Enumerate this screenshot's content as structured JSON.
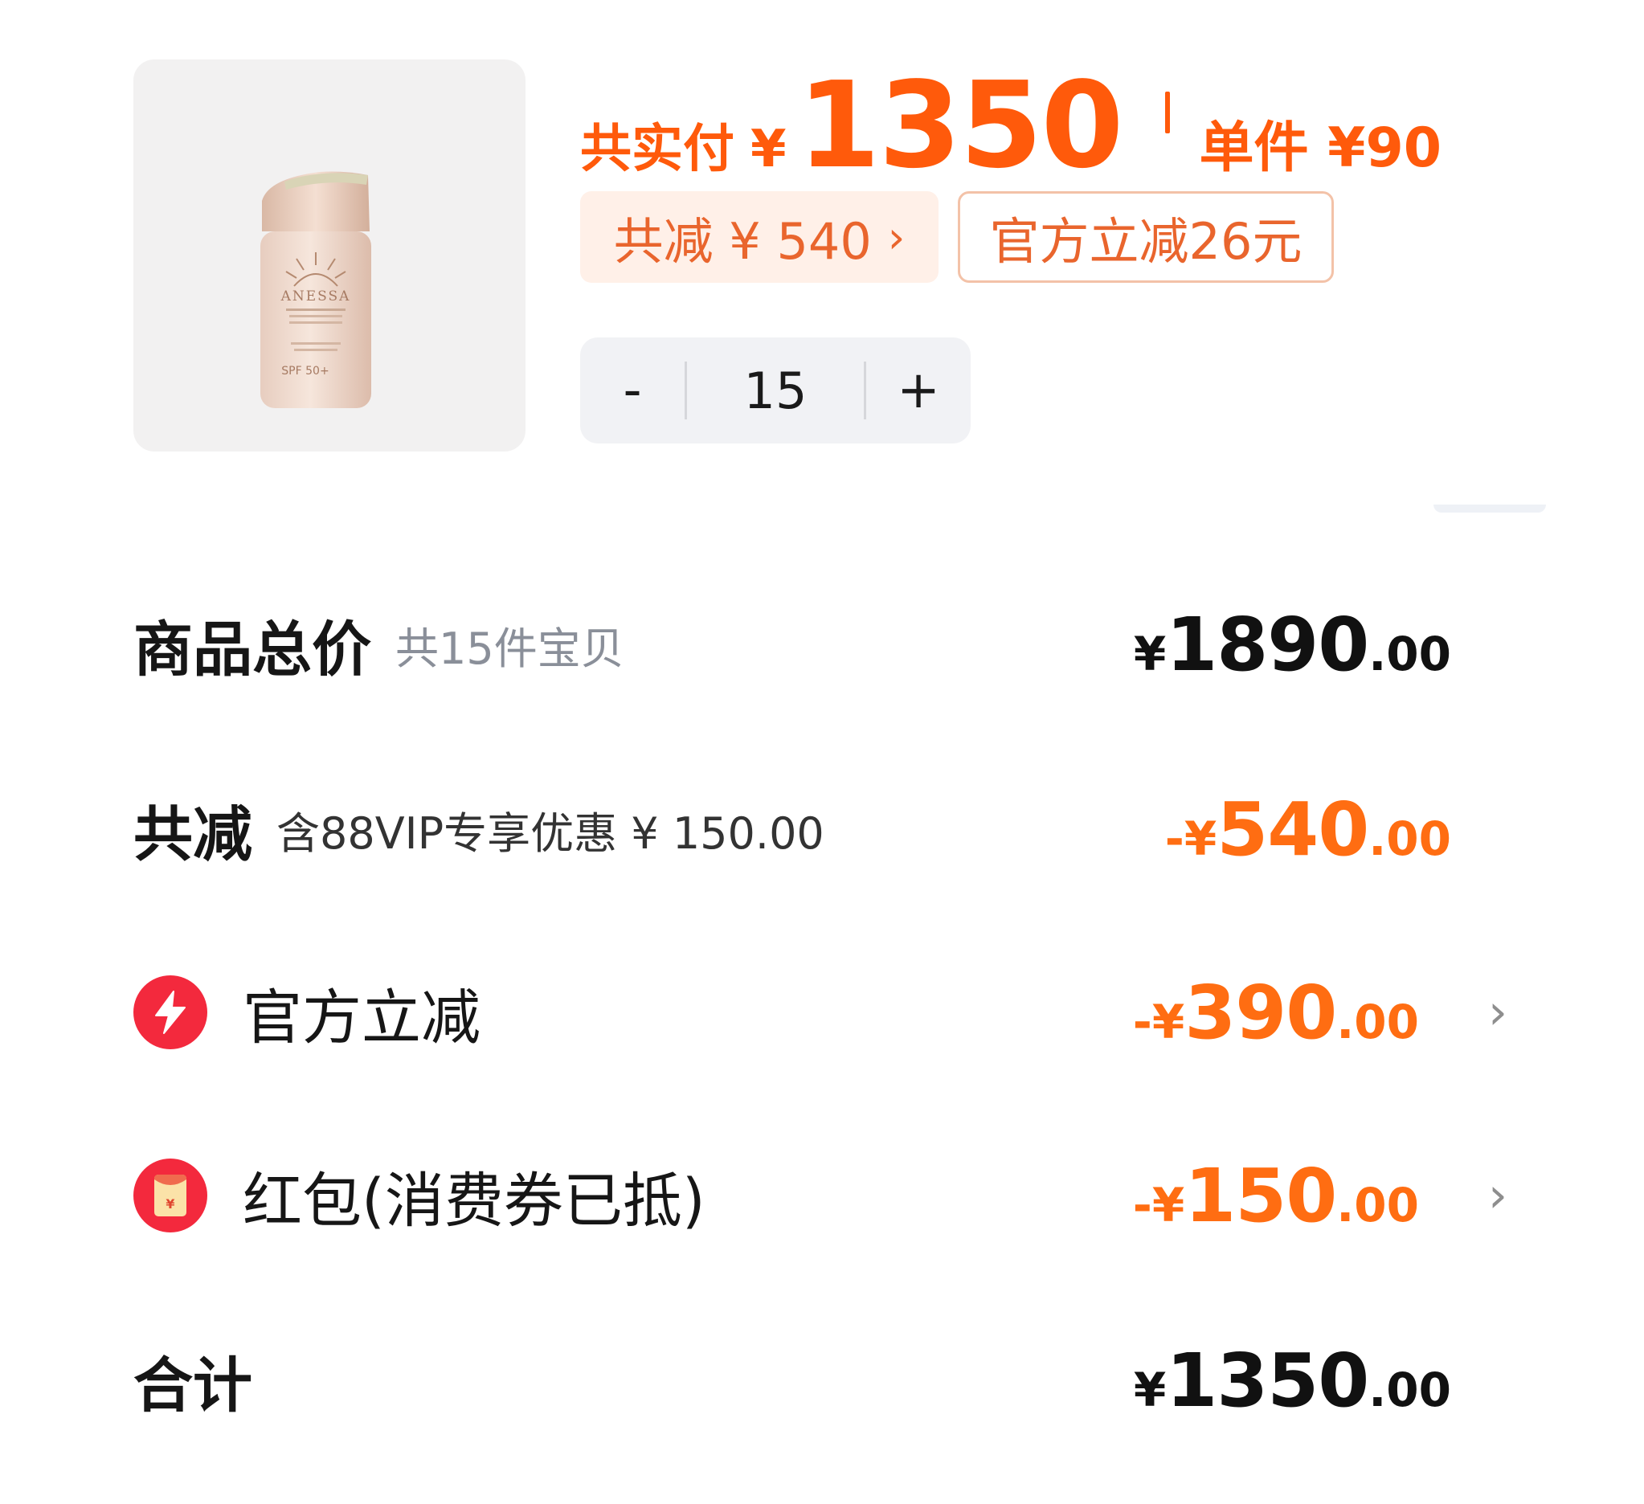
{
  "product": {
    "image_alt": "ANESSA",
    "bottle_brand": "ANESSA",
    "bottle_spf": "SPF 50+"
  },
  "header": {
    "pay_prefix": "共实付",
    "yen": "¥",
    "pay_amount": "1350",
    "unit_price": "单件 ¥90"
  },
  "tags": {
    "discount": "共减 ¥ 540",
    "discount_chevron": "›",
    "official": "官方立减26元"
  },
  "stepper": {
    "minus": "-",
    "quantity": "15",
    "plus": "+"
  },
  "summary": {
    "total_label": "商品总价",
    "total_sub": "共15件宝贝",
    "total_yen": "¥",
    "total_int": "1890",
    "total_dec": ".00",
    "discount_label": "共减",
    "discount_sub": "含88VIP专享优惠 ¥ 150.00",
    "discount_yen": "-¥",
    "discount_int": "540",
    "discount_dec": ".00",
    "official_label": "官方立减",
    "official_yen": "-¥",
    "official_int": "390",
    "official_dec": ".00",
    "redpacket_label": "红包(消费券已抵)",
    "redpacket_yen": "-¥",
    "redpacket_int": "150",
    "redpacket_dec": ".00",
    "sum_label": "合计",
    "sum_yen": "¥",
    "sum_int": "1350",
    "sum_dec": ".00",
    "chevron": "›"
  },
  "colors": {
    "accent": "#ff5a0b",
    "badge_red": "#f3293d"
  },
  "icons": [
    "lightning-icon",
    "red-packet-icon",
    "chevron-right-icon"
  ]
}
